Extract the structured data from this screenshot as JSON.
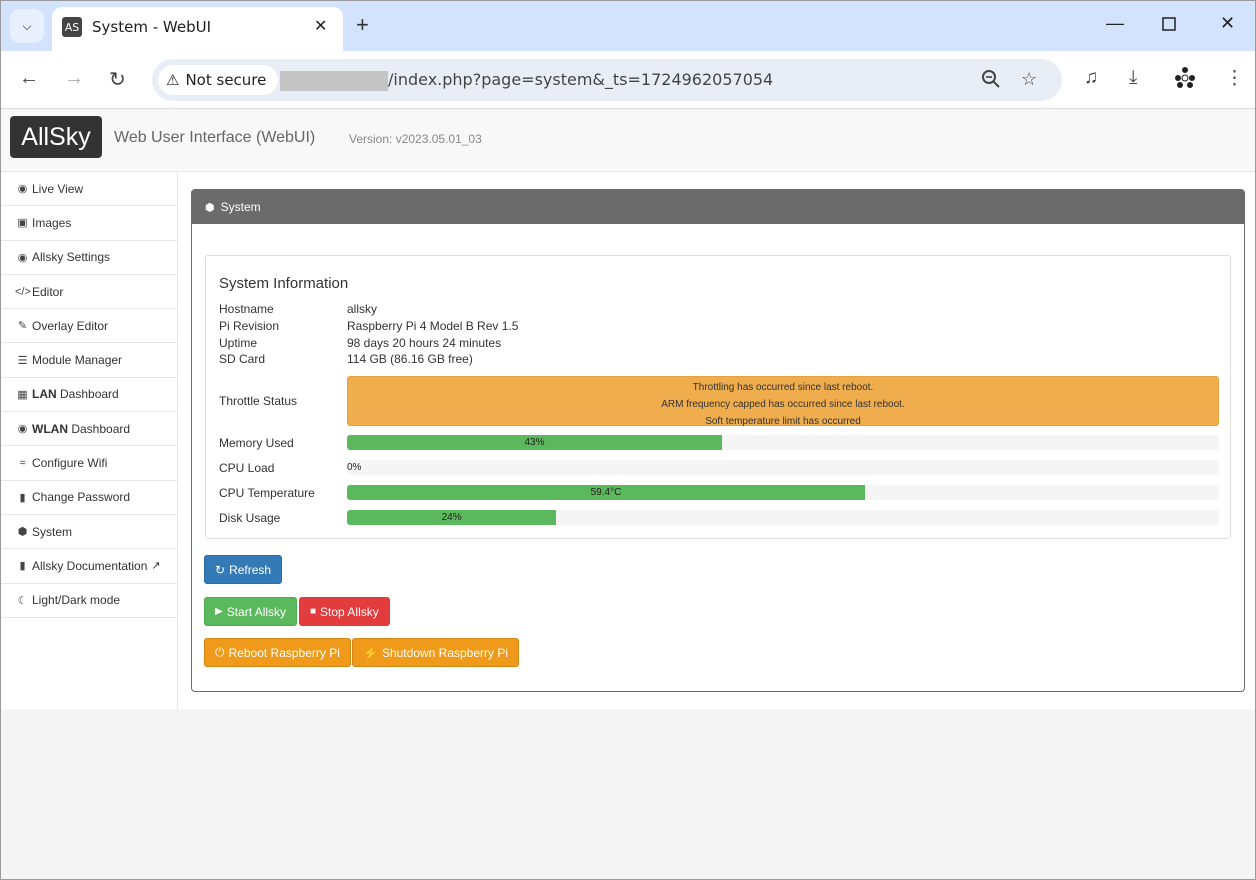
{
  "browser": {
    "tab_title": "System - WebUI",
    "tab_favicon": "AS",
    "security_label": "Not secure",
    "url": "/index.php?page=system&_ts=1724962057054"
  },
  "header": {
    "logo": "AllSky",
    "brand": "Web User Interface (WebUI)",
    "version": "Version: v2023.05.01_03"
  },
  "sidebar": {
    "items": [
      {
        "icon": "eye-icon",
        "label": "Live View"
      },
      {
        "icon": "image-icon",
        "label": "Images"
      },
      {
        "icon": "camera-icon",
        "label": "Allsky Settings"
      },
      {
        "icon": "code-icon",
        "label": "Editor"
      },
      {
        "icon": "edit-icon",
        "label": "Overlay Editor"
      },
      {
        "icon": "list-icon",
        "label": "Module Manager"
      },
      {
        "icon": "network-icon",
        "label_bold": "LAN",
        "label_rest": " Dashboard"
      },
      {
        "icon": "globe-icon",
        "label_bold": "WLAN",
        "label_rest": " Dashboard"
      },
      {
        "icon": "wifi-icon",
        "label": "Configure Wifi"
      },
      {
        "icon": "lock-icon",
        "label": "Change Password"
      },
      {
        "icon": "cube-icon",
        "label": "System"
      },
      {
        "icon": "book-icon",
        "label": "Allsky Documentation"
      },
      {
        "icon": "moon-icon",
        "label": "Light/Dark mode"
      }
    ]
  },
  "panel": {
    "title": "System"
  },
  "info": {
    "title": "System Information",
    "hostname_label": "Hostname",
    "hostname": "allsky",
    "pi_revision_label": "Pi Revision",
    "pi_revision": "Raspberry Pi 4 Model B Rev 1.5",
    "uptime_label": "Uptime",
    "uptime": "98 days 20 hours 24 minutes",
    "sdcard_label": "SD Card",
    "sdcard": "114 GB (86.16 GB free)",
    "throttle_label": "Throttle Status",
    "throttle_lines": [
      "Throttling has occurred since last reboot.",
      "ARM frequency capped has occurred since last reboot.",
      "Soft temperature limit has occurred"
    ],
    "memory_label": "Memory Used",
    "memory_text": "43%",
    "memory_pct": 43,
    "cpu_load_label": "CPU Load",
    "cpu_load_text": "0%",
    "cpu_load_pct": 0,
    "cpu_temp_label": "CPU Temperature",
    "cpu_temp_text": "59.4°C",
    "cpu_temp_pct": 59.4,
    "disk_label": "Disk Usage",
    "disk_text": "24%",
    "disk_pct": 24
  },
  "buttons": {
    "refresh": "Refresh",
    "start": "Start Allsky",
    "stop": "Stop Allsky",
    "reboot": "Reboot Raspberry Pi",
    "shutdown": "Shutdown Raspberry Pi"
  },
  "colors": {
    "progress": "#5cb85c",
    "warning": "#f0ad4e",
    "primary": "#337ab7",
    "danger": "#e33c3c",
    "orange": "#ef9a1a"
  }
}
